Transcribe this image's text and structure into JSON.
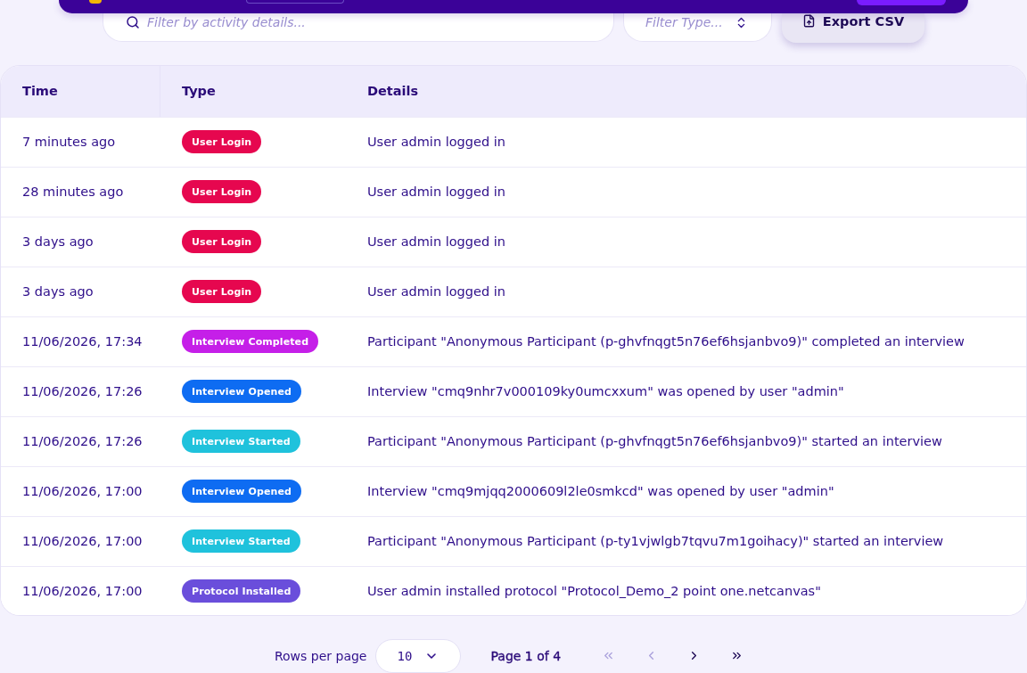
{
  "toolbar": {
    "search": {
      "placeholder": "Filter by activity details..."
    },
    "type_filter": {
      "placeholder": "Filter Type..."
    },
    "export_button": {
      "label": "Export CSV"
    }
  },
  "table": {
    "columns": [
      "Time",
      "Type",
      "Details"
    ],
    "rows": [
      {
        "time": "7 minutes ago",
        "type": {
          "label": "User Login",
          "color": "#e6074f"
        },
        "details": "User admin logged in"
      },
      {
        "time": "28 minutes ago",
        "type": {
          "label": "User Login",
          "color": "#e6074f"
        },
        "details": "User admin logged in"
      },
      {
        "time": "3 days ago",
        "type": {
          "label": "User Login",
          "color": "#e6074f"
        },
        "details": "User admin logged in"
      },
      {
        "time": "3 days ago",
        "type": {
          "label": "User Login",
          "color": "#e6074f"
        },
        "details": "User admin logged in"
      },
      {
        "time": "11/06/2026, 17:34",
        "type": {
          "label": "Interview Completed",
          "color": "#c51fe8"
        },
        "details": "Participant \"Anonymous Participant (p-ghvfnqgt5n76ef6hsjanbvo9)\" completed an interview"
      },
      {
        "time": "11/06/2026, 17:26",
        "type": {
          "label": "Interview Opened",
          "color": "#0e6cf2"
        },
        "details": "Interview \"cmq9nhr7v000109ky0umcxxum\" was opened by user \"admin\""
      },
      {
        "time": "11/06/2026, 17:26",
        "type": {
          "label": "Interview Started",
          "color": "#1fc2dc"
        },
        "details": "Participant \"Anonymous Participant (p-ghvfnqgt5n76ef6hsjanbvo9)\" started an interview"
      },
      {
        "time": "11/06/2026, 17:00",
        "type": {
          "label": "Interview Opened",
          "color": "#0e6cf2"
        },
        "details": "Interview \"cmq9mjqq2000609l2le0smkcd\" was opened by user \"admin\""
      },
      {
        "time": "11/06/2026, 17:00",
        "type": {
          "label": "Interview Started",
          "color": "#1fc2dc"
        },
        "details": "Participant \"Anonymous Participant (p-ty1vjwlgb7tqvu7m1goihacy)\" started an interview"
      },
      {
        "time": "11/06/2026, 17:00",
        "type": {
          "label": "Protocol Installed",
          "color": "#6a4edb"
        },
        "details": "User admin installed protocol \"Protocol_Demo_2 point one.netcanvas\""
      }
    ]
  },
  "pagination": {
    "rows_per_page_label": "Rows per page",
    "rows_per_page": "10",
    "page_label": "Page 1 of 4",
    "buttons": [
      {
        "kind": "first",
        "disabled": true
      },
      {
        "kind": "previous",
        "disabled": true
      },
      {
        "kind": "next",
        "disabled": false
      },
      {
        "kind": "last",
        "disabled": false
      }
    ]
  }
}
